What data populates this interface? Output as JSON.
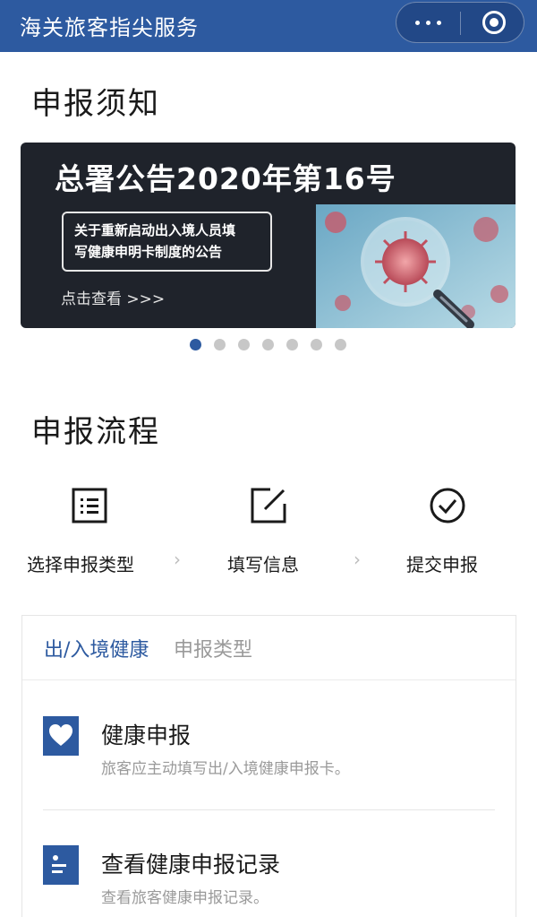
{
  "header": {
    "title": "海关旅客指尖服务",
    "more_icon": "more-dots-icon",
    "close_icon": "target-icon"
  },
  "notice": {
    "section_title": "申报须知",
    "banner": {
      "headline": "总署公告2020年第16号",
      "notice_line1": "关于重新启动出入境人员填",
      "notice_line2": "写健康申明卡制度的公告",
      "link": "点击查看 >>>"
    },
    "carousel": {
      "total": 7,
      "active_index": 0
    }
  },
  "process": {
    "section_title": "申报流程",
    "steps": [
      {
        "label": "选择申报类型",
        "icon": "list-icon"
      },
      {
        "label": "填写信息",
        "icon": "edit-icon"
      },
      {
        "label": "提交申报",
        "icon": "check-circle-icon"
      }
    ],
    "separator": "›"
  },
  "declaration_type": {
    "header_highlight": "出/入境健康",
    "header_rest": "申报类型",
    "items": [
      {
        "title": "健康申报",
        "desc": "旅客应主动填写出/入境健康申报卡。",
        "icon": "heart-icon"
      },
      {
        "title": "查看健康申报记录",
        "desc": "查看旅客健康申报记录。",
        "icon": "record-icon"
      }
    ]
  },
  "colors": {
    "brand_blue": "#2d5aa0",
    "banner_bg": "#1f232b",
    "inactive_dot": "#c7c7c7",
    "muted_text": "#9a9a9a"
  }
}
